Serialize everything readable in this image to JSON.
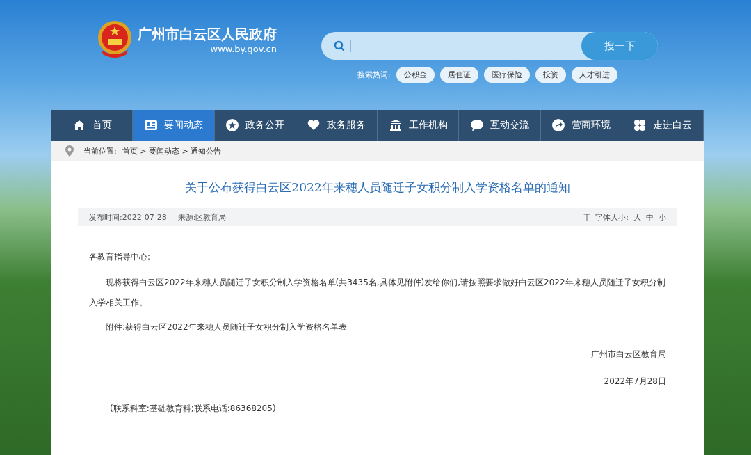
{
  "header": {
    "site_name": "广州市白云区人民政府",
    "domain": "www.by.gov.cn",
    "search": {
      "button": "搜一下",
      "hot_label": "搜索热词:",
      "hot_tags": [
        "公积金",
        "居住证",
        "医疗保险",
        "投资",
        "人才引进"
      ]
    }
  },
  "nav": [
    {
      "label": "首页",
      "selected": false
    },
    {
      "label": "要闻动态",
      "selected": true
    },
    {
      "label": "政务公开",
      "selected": false
    },
    {
      "label": "政务服务",
      "selected": false
    },
    {
      "label": "工作机构",
      "selected": false
    },
    {
      "label": "互动交流",
      "selected": false
    },
    {
      "label": "营商环境",
      "selected": false
    },
    {
      "label": "走进白云",
      "selected": false
    }
  ],
  "breadcrumb": {
    "label": "当前位置:",
    "path": "首页 > 要闻动态 > 通知公告"
  },
  "article": {
    "title": "关于公布获得白云区2022年来穗人员随迁子女积分制入学资格名单的通知",
    "meta": {
      "date": "发布时间:2022-07-28",
      "source": "来源:区教育局",
      "font_size_label": "字体大小:",
      "font_sizes": [
        "大",
        "中",
        "小"
      ]
    },
    "greeting": "各教育指导中心:",
    "paragraphs": [
      "现将获得白云区2022年来穗人员随迁子女积分制入学资格名单(共3435名,具体见附件)发给你们,请按照要求做好白云区2022年来穗人员随迁子女积分制入学相关工作。",
      "附件:获得白云区2022年来穗人员随迁子女积分制入学资格名单表"
    ],
    "signature": "广州市白云区教育局",
    "sign_date": "2022年7月28日",
    "contact": "(联系科室:基础教育科;联系电话:86368205)"
  }
}
